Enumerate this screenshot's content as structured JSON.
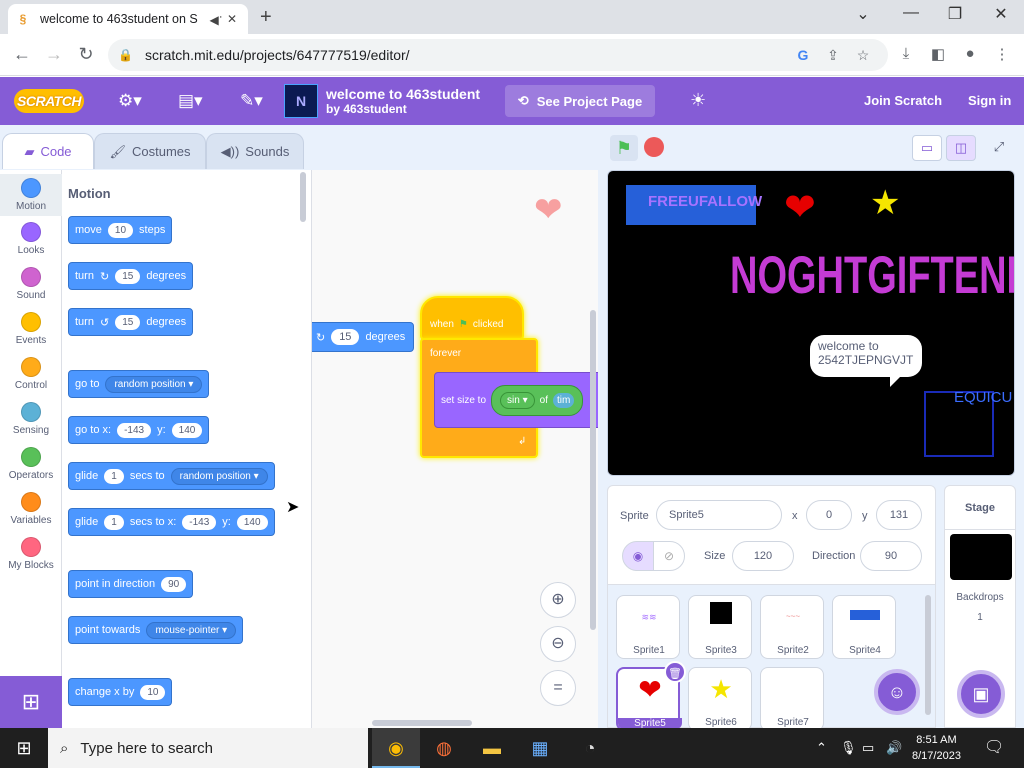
{
  "browser": {
    "tab_title": "welcome to 463student on S",
    "url": "scratch.mit.edu/projects/647777519/editor/",
    "icons": [
      "back-icon",
      "forward-icon",
      "reload-icon",
      "lock-icon",
      "google-icon",
      "share-icon",
      "star-icon",
      "download-icon",
      "sidebar-icon",
      "profile-icon",
      "menu-icon"
    ]
  },
  "menubar": {
    "logo": "SCRATCH",
    "project_title": "welcome to 463student",
    "author": "by 463student",
    "see_project": "See Project Page",
    "join": "Join Scratch",
    "sign_in": "Sign in"
  },
  "editor_tabs": [
    "Code",
    "Costumes",
    "Sounds"
  ],
  "categories": [
    {
      "label": "Motion",
      "color": "#4c97ff"
    },
    {
      "label": "Looks",
      "color": "#9966ff"
    },
    {
      "label": "Sound",
      "color": "#cf63cf"
    },
    {
      "label": "Events",
      "color": "#ffbf00"
    },
    {
      "label": "Control",
      "color": "#ffab19"
    },
    {
      "label": "Sensing",
      "color": "#5cb1d6"
    },
    {
      "label": "Operators",
      "color": "#59c059"
    },
    {
      "label": "Variables",
      "color": "#ff8c1a"
    },
    {
      "label": "My Blocks",
      "color": "#ff6680"
    }
  ],
  "palette": {
    "heading": "Motion",
    "move": {
      "a": "move",
      "n": "10",
      "b": "steps"
    },
    "turn_right": {
      "a": "turn",
      "n": "15",
      "b": "degrees"
    },
    "turn_left": {
      "a": "turn",
      "n": "15",
      "b": "degrees"
    },
    "goto": {
      "a": "go to",
      "dd": "random position"
    },
    "goto_xy": {
      "a": "go to x:",
      "x": "-143",
      "b": "y:",
      "y": "140"
    },
    "glide": {
      "a": "glide",
      "n": "1",
      "b": "secs to",
      "dd": "random position"
    },
    "glide_xy": {
      "a": "glide",
      "n": "1",
      "b": "secs to x:",
      "x": "-143",
      "c": "y:",
      "y": "140"
    },
    "point_dir": {
      "a": "point in direction",
      "n": "90"
    },
    "point_towards": {
      "a": "point towards",
      "dd": "mouse-pointer"
    },
    "change_x": {
      "a": "change x by",
      "n": "10"
    }
  },
  "script": {
    "drag_block": {
      "a": "turn",
      "n": "15",
      "b": "degrees"
    },
    "when_clicked": {
      "a": "when",
      "b": "clicked"
    },
    "forever": "forever",
    "set_size": {
      "a": "set size to",
      "op": "sin",
      "of": "of",
      "tm": "tim"
    }
  },
  "stage": {
    "text1": "FREEUFALLOW",
    "text2": "NOGHTGIFTENFS",
    "text3": "EQUICU",
    "bubble": "welcome to 2542TJEPNGVJT"
  },
  "sprite_info": {
    "sprite_label": "Sprite",
    "sprite_name": "Sprite5",
    "x_label": "x",
    "x": "0",
    "y_label": "y",
    "y": "131",
    "size_label": "Size",
    "size": "120",
    "direction_label": "Direction",
    "direction": "90"
  },
  "sprites": [
    "Sprite1",
    "Sprite3",
    "Sprite2",
    "Sprite4",
    "Sprite5",
    "Sprite6",
    "Sprite7"
  ],
  "stage_pane": {
    "title": "Stage",
    "backdrops": "Backdrops",
    "count": "1"
  },
  "taskbar": {
    "search": "Type here to search",
    "time": "8:51 AM",
    "date": "8/17/2023"
  }
}
